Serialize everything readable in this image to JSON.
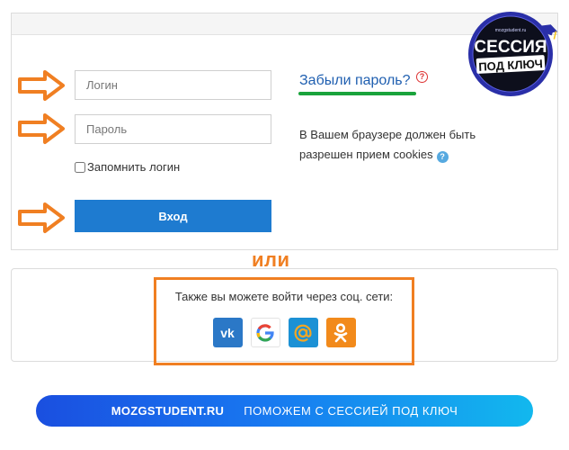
{
  "login": {
    "username_placeholder": "Логин",
    "password_placeholder": "Пароль",
    "remember_label": "Запомнить логин",
    "submit_label": "Вход",
    "forgot_label": "Забыли пароль?",
    "help_symbol": "?",
    "cookie_note": "В Вашем браузере должен быть разрешен прием cookies"
  },
  "separator": "или",
  "social": {
    "prompt": "Также вы можете войти через соц. сети:",
    "providers": [
      {
        "name": "vk",
        "icon": "vk-icon",
        "color": "#2b78c7"
      },
      {
        "name": "google",
        "icon": "google-icon",
        "color": "#ffffff"
      },
      {
        "name": "mail.ru",
        "icon": "at-sign-icon",
        "color": "#1c91d5"
      },
      {
        "name": "odnoklassniki",
        "icon": "ok-icon",
        "color": "#f28a1b"
      }
    ]
  },
  "badge": {
    "site": "mozgstudent.ru",
    "line1": "СЕССИЯ",
    "line2": "ПОД КЛЮЧ"
  },
  "banner": {
    "brand": "MOZGSTUDENT.RU",
    "slogan": "ПОМОЖЕМ С СЕССИЕЙ ПОД КЛЮЧ"
  },
  "colors": {
    "accent_orange": "#f07f22",
    "button_blue": "#1e7bd0",
    "link_blue": "#1f5fb0",
    "underline_green": "#1aa33c"
  }
}
